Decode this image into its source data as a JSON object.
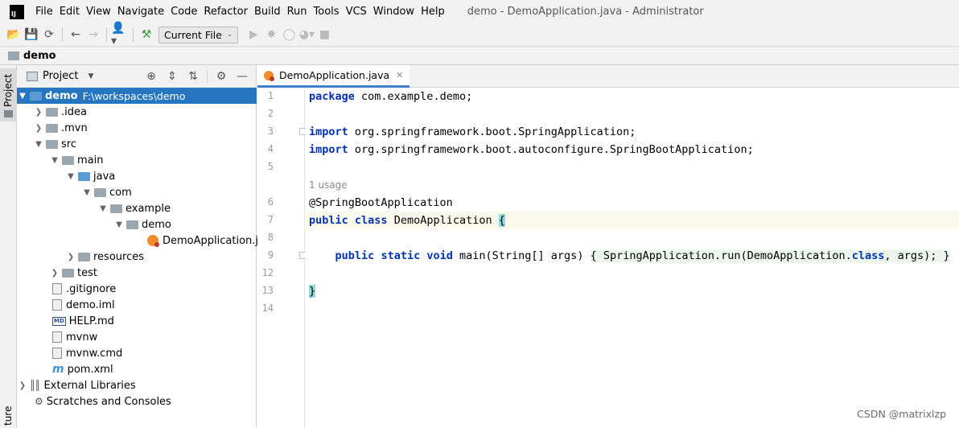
{
  "menubar": {
    "items": [
      "File",
      "Edit",
      "View",
      "Navigate",
      "Code",
      "Refactor",
      "Build",
      "Run",
      "Tools",
      "VCS",
      "Window",
      "Help"
    ],
    "window_title": "demo - DemoApplication.java - Administrator"
  },
  "toolbar": {
    "run_config": "Current File"
  },
  "navbar": {
    "breadcrumb": "demo"
  },
  "side": {
    "project_tab": "Project",
    "bottom_tab": "ture"
  },
  "project_panel": {
    "title": "Project",
    "tree": [
      {
        "label": "demo",
        "hint": "F:\\workspaces\\demo"
      },
      {
        "label": ".idea"
      },
      {
        "label": ".mvn"
      },
      {
        "label": "src"
      },
      {
        "label": "main"
      },
      {
        "label": "java"
      },
      {
        "label": "com"
      },
      {
        "label": "example"
      },
      {
        "label": "demo"
      },
      {
        "label": "DemoApplication.java"
      },
      {
        "label": "resources"
      },
      {
        "label": "test"
      },
      {
        "label": ".gitignore"
      },
      {
        "label": "demo.iml"
      },
      {
        "label": "HELP.md"
      },
      {
        "label": "mvnw"
      },
      {
        "label": "mvnw.cmd"
      },
      {
        "label": "pom.xml"
      },
      {
        "label": "External Libraries"
      },
      {
        "label": "Scratches and Consoles"
      }
    ]
  },
  "editor": {
    "tab_label": "DemoApplication.java",
    "line_numbers": [
      "1",
      "2",
      "3",
      "4",
      "5",
      "6",
      "7",
      "8",
      "9",
      "12",
      "13",
      "14"
    ],
    "usage_hint": "1 usage",
    "code": {
      "l1_kw": "package",
      "l1_rest": " com.example.demo;",
      "l3_kw": "import",
      "l3_rest": " org.springframework.boot.SpringApplication;",
      "l4_kw": "import",
      "l4_rest": " org.springframework.boot.autoconfigure.SpringBootApplication;",
      "l6": "@SpringBootApplication",
      "l7_kw1": "public",
      "l7_kw2": "class",
      "l7_name": "DemoApplication",
      "l7_brace": "{",
      "l9_kw1": "public",
      "l9_kw2": "static",
      "l9_kw3": "void",
      "l9_sig": "main(String[] args)",
      "l9_body_open": "{",
      "l9_body": " SpringApplication.run(DemoApplication.",
      "l9_kw4": "class",
      "l9_body_end": ", args); ",
      "l9_body_close": "}",
      "l13_brace": "}"
    }
  },
  "watermark": "CSDN @matrixlzp"
}
